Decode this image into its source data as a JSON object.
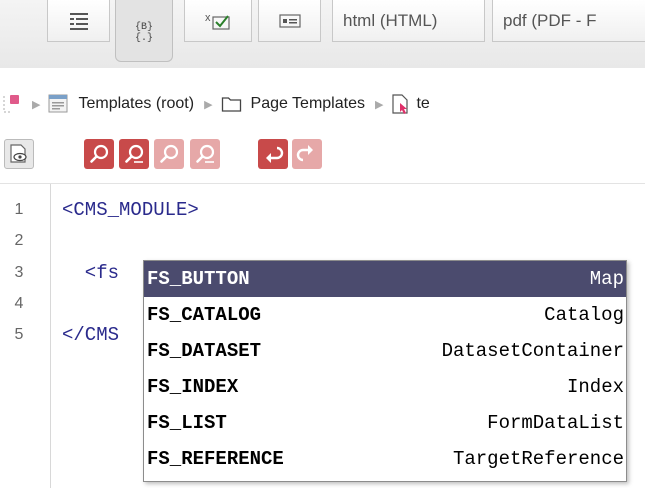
{
  "tabs": [
    {
      "icon": "list-view-icon",
      "label": ""
    },
    {
      "icon": "source-code-icon",
      "label": ""
    },
    {
      "icon": "checkbox-form-icon",
      "label": ""
    },
    {
      "icon": "layout-view-icon",
      "label": ""
    },
    {
      "label": "html (HTML)"
    },
    {
      "label": "pdf (PDF - F"
    }
  ],
  "breadcrumb": {
    "root_label": "Templates (root)",
    "folder_label": "Page Templates",
    "current_label": "te"
  },
  "toolbar": {
    "buttons": [
      "preview-icon",
      "find-icon",
      "find-replace-icon",
      "find-next-icon",
      "find-previous-icon",
      "undo-icon",
      "redo-icon"
    ]
  },
  "editor": {
    "lines": [
      {
        "number": "1",
        "text": "<CMS_MODULE>"
      },
      {
        "number": "2",
        "text": ""
      },
      {
        "number": "3",
        "text": "  <fs"
      },
      {
        "number": "4",
        "text": ""
      },
      {
        "number": "5",
        "text": "</CMS"
      }
    ]
  },
  "autocomplete": {
    "items": [
      {
        "name": "FS_BUTTON",
        "type": "Map",
        "selected": true
      },
      {
        "name": "FS_CATALOG",
        "type": "Catalog",
        "selected": false
      },
      {
        "name": "FS_DATASET",
        "type": "DatasetContainer",
        "selected": false
      },
      {
        "name": "FS_INDEX",
        "type": "Index",
        "selected": false
      },
      {
        "name": "FS_LIST",
        "type": "FormDataList",
        "selected": false
      },
      {
        "name": "FS_REFERENCE",
        "type": "TargetReference",
        "selected": false
      }
    ]
  },
  "colors": {
    "selection_bg": "#4b4b6e",
    "code_text": "#2a2a8c",
    "toolbar_red": "#c84a4a"
  }
}
